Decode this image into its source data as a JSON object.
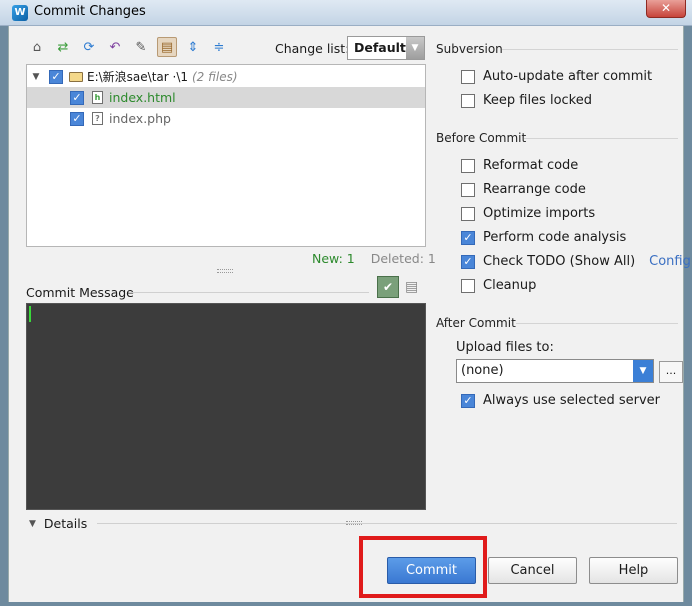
{
  "window": {
    "title": "Commit Changes",
    "close_symbol": "✕",
    "app_icon_letter": "W"
  },
  "toolbar": {
    "icons": [
      "shelve-icon",
      "move-icon",
      "refresh-icon",
      "undo-icon",
      "diff-icon",
      "group-by-directory-icon",
      "expand-all-icon",
      "collapse-all-icon"
    ],
    "changelist_label": "Change list:",
    "changelist_value": "Default"
  },
  "tree": {
    "root_label": "E:\\新浪sae\\tar   ·\\1",
    "root_count": "(2 files)",
    "files": [
      {
        "name": "index.html",
        "status": "new"
      },
      {
        "name": "index.php",
        "status": "unversioned"
      }
    ]
  },
  "counts": {
    "new": "New: 1",
    "deleted": "Deleted: 1"
  },
  "commit_message": {
    "label": "Commit Message",
    "value": ""
  },
  "details": {
    "label": "Details"
  },
  "subversion": {
    "title": "Subversion",
    "options": [
      {
        "label": "Auto-update after commit",
        "checked": false
      },
      {
        "label": "Keep files locked",
        "checked": false
      }
    ]
  },
  "before_commit": {
    "title": "Before Commit",
    "options": [
      {
        "label": "Reformat code",
        "checked": false
      },
      {
        "label": "Rearrange code",
        "checked": false
      },
      {
        "label": "Optimize imports",
        "checked": false
      },
      {
        "label": "Perform code analysis",
        "checked": true
      },
      {
        "label": "Check TODO (Show All)",
        "checked": true,
        "link": "Configure"
      },
      {
        "label": "Cleanup",
        "checked": false
      }
    ]
  },
  "after_commit": {
    "title": "After Commit",
    "upload_label": "Upload files to:",
    "server_value": "(none)",
    "browse_label": "...",
    "always_use_label": "Always use selected server",
    "always_use_checked": true
  },
  "buttons": {
    "commit": "Commit",
    "cancel": "Cancel",
    "help": "Help"
  },
  "colors": {
    "primary_button": "#3a78d2",
    "highlight": "#e01b1b",
    "new_file": "#2d8a2d",
    "link": "#3a6fc2"
  }
}
